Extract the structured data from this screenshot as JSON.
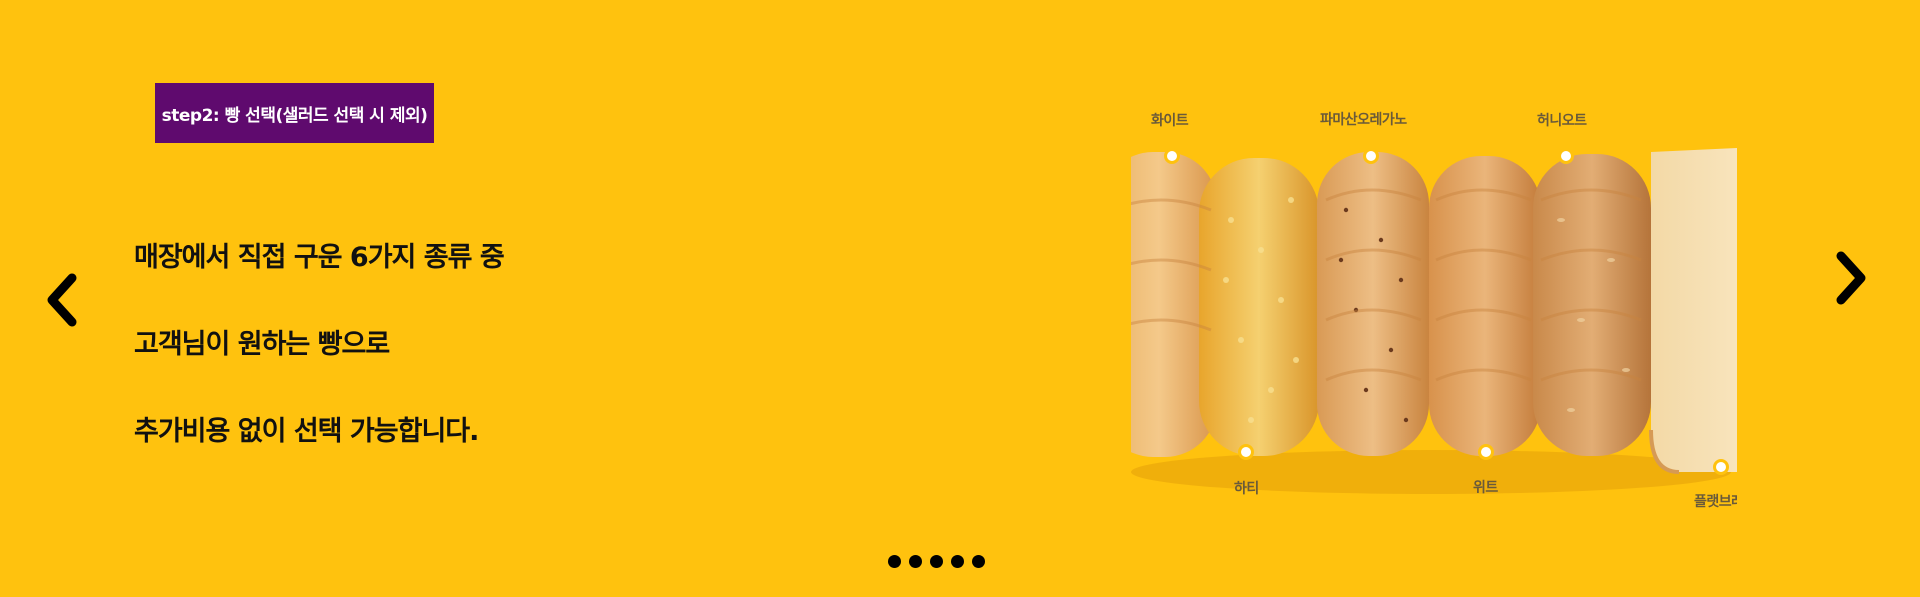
{
  "step": {
    "label": "step2: 빵 선택(샐러드 선택 시 제외)"
  },
  "description": {
    "line1": "매장에서 직접 구운 6가지 종류 중",
    "line2": "고객님이 원하는 빵으로",
    "line3": "추가비용 없이 선택 가능합니다."
  },
  "breads": {
    "white": "화이트",
    "parmesan_oregano": "파마산오레가노",
    "honey_oat": "허니오트",
    "hearty": "하티",
    "wheat": "위트",
    "flatbread": "플랫브레"
  },
  "nav": {
    "prev_icon": "chevron-left-icon",
    "next_icon": "chevron-right-icon"
  },
  "pagination": {
    "count": 5
  },
  "colors": {
    "background": "#FFC20E",
    "badge": "#5F0A6E"
  }
}
